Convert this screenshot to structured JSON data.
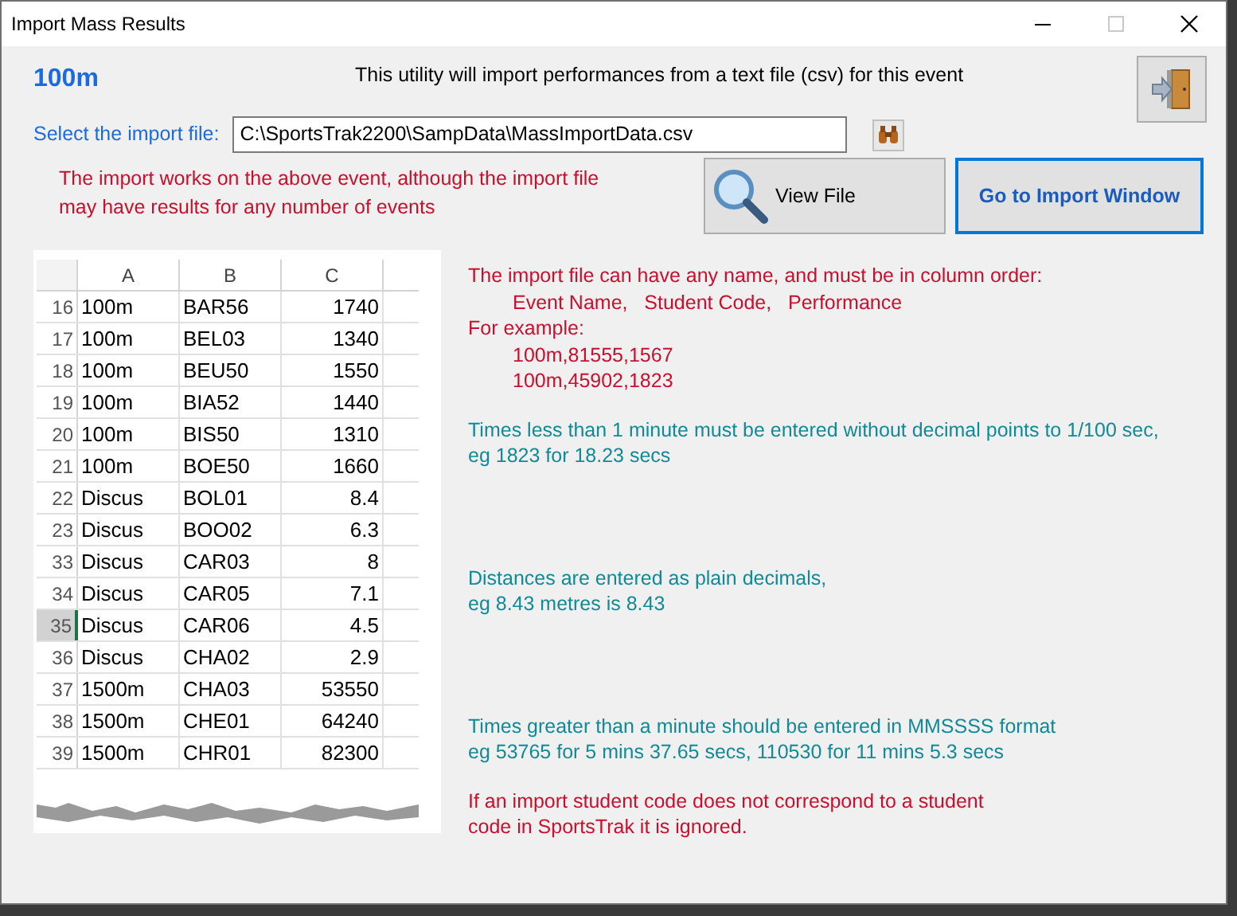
{
  "window": {
    "title": "Import Mass Results"
  },
  "event": "100m",
  "intro": "This utility will import performances from a text file (csv)  for this event",
  "file": {
    "label": "Select the import file:",
    "value": "C:\\SportsTrak2200\\SampData\\MassImportData.csv"
  },
  "warning": [
    "The import works on the above event, although the import file",
    "may have results for any number of events"
  ],
  "buttons": [
    {
      "label": "View File",
      "kind": "view",
      "selected": false
    },
    {
      "label": "Go to Import Window",
      "kind": "go",
      "selected": true
    }
  ],
  "sheet": {
    "columns": [
      "A",
      "B",
      "C"
    ],
    "rows": [
      {
        "num": "16",
        "cells": [
          "100m",
          "BAR56",
          "1740"
        ],
        "selected": false
      },
      {
        "num": "17",
        "cells": [
          "100m",
          "BEL03",
          "1340"
        ],
        "selected": false
      },
      {
        "num": "18",
        "cells": [
          "100m",
          "BEU50",
          "1550"
        ],
        "selected": false
      },
      {
        "num": "19",
        "cells": [
          "100m",
          "BIA52",
          "1440"
        ],
        "selected": false
      },
      {
        "num": "20",
        "cells": [
          "100m",
          "BIS50",
          "1310"
        ],
        "selected": false
      },
      {
        "num": "21",
        "cells": [
          "100m",
          "BOE50",
          "1660"
        ],
        "selected": false
      },
      {
        "num": "22",
        "cells": [
          "Discus",
          "BOL01",
          "8.4"
        ],
        "selected": false
      },
      {
        "num": "23",
        "cells": [
          "Discus",
          "BOO02",
          "6.3"
        ],
        "selected": false
      },
      {
        "num": "33",
        "cells": [
          "Discus",
          "CAR03",
          "8"
        ],
        "selected": false
      },
      {
        "num": "34",
        "cells": [
          "Discus",
          "CAR05",
          "7.1"
        ],
        "selected": false
      },
      {
        "num": "35",
        "cells": [
          "Discus",
          "CAR06",
          "4.5"
        ],
        "selected": true
      },
      {
        "num": "36",
        "cells": [
          "Discus",
          "CHA02",
          "2.9"
        ],
        "selected": false
      },
      {
        "num": "37",
        "cells": [
          "1500m",
          "CHA03",
          "53550"
        ],
        "selected": false
      },
      {
        "num": "38",
        "cells": [
          "1500m",
          "CHE01",
          "64240"
        ],
        "selected": false
      },
      {
        "num": "39",
        "cells": [
          "1500m",
          "CHR01",
          "82300"
        ],
        "selected": false
      }
    ]
  },
  "notes": [
    {
      "kind": "red",
      "lines": [
        "The import file can have any name, and must be in column order:"
      ],
      "indented": [
        "Event Name,   Student Code,   Performance"
      ]
    },
    {
      "kind": "red",
      "lines": [
        "For example:"
      ],
      "indented": [
        "100m,81555,1567",
        "100m,45902,1823"
      ]
    },
    {
      "kind": "teal",
      "lines": [
        "Times less than 1 minute must be entered without decimal points to 1/100 sec,",
        "eg 1823 for 18.23 secs"
      ]
    },
    {
      "kind": "teal",
      "lines": [
        "Distances are entered as plain decimals,",
        "eg 8.43 metres is 8.43"
      ]
    },
    {
      "kind": "teal",
      "lines": [
        "Times greater than a minute should be entered in MMSSSS format",
        "eg 53765 for 5 mins 37.65 secs, 110530 for 11 mins 5.3 secs"
      ]
    },
    {
      "kind": "red",
      "lines": [
        "If an import student code does not correspond to a student",
        "code in SportsTrak it is ignored."
      ]
    }
  ]
}
